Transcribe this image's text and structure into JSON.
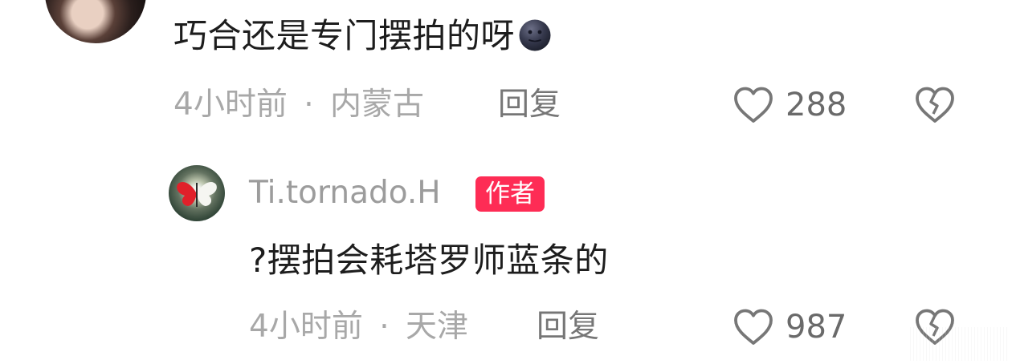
{
  "comment": {
    "text": "巧合还是专门摆拍的呀",
    "emoji_icon": "new-moon-face-icon",
    "time": "4小时前",
    "separator": "·",
    "location": "内蒙古",
    "reply_label": "回复",
    "like_count": "288",
    "like_icon": "heart-outline-icon",
    "dislike_icon": "broken-heart-outline-icon"
  },
  "reply": {
    "author_name": "Ti.tornado.H",
    "author_badge": "作者",
    "text": "?摆拍会耗塔罗师蓝条的",
    "time": "4小时前",
    "separator": "·",
    "location": "天津",
    "reply_label": "回复",
    "like_count": "987",
    "like_icon": "heart-outline-icon",
    "dislike_icon": "broken-heart-outline-icon"
  },
  "colors": {
    "badge_red": "#fe2c55",
    "meta_gray": "#a8a8a8",
    "text_dark": "#1d1d1d"
  }
}
